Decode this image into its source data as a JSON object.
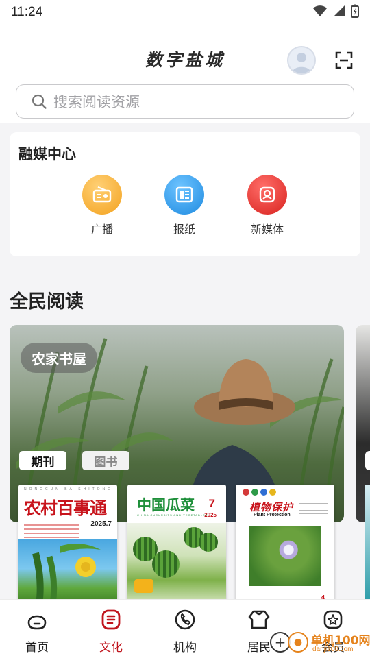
{
  "status_bar": {
    "time": "11:24"
  },
  "header": {
    "title": "数字盐城",
    "search_placeholder": "搜索阅读资源"
  },
  "media_center": {
    "title": "融媒中心",
    "items": [
      {
        "label": "广播",
        "icon": "radio-icon",
        "color": "#f6a92e"
      },
      {
        "label": "报纸",
        "icon": "newspaper-icon",
        "color": "#2f9ae6"
      },
      {
        "label": "新媒体",
        "icon": "new-media-icon",
        "color": "#e43532"
      }
    ]
  },
  "reading": {
    "section_title": "全民阅读",
    "banner_badge": "农家书屋",
    "tabs": [
      {
        "label": "期刊",
        "active": true
      },
      {
        "label": "图书",
        "active": false
      }
    ],
    "books": [
      {
        "subtitle": "NONGCUN BAISHITONG",
        "title": "农村百事通",
        "issue": "2025.7"
      },
      {
        "title": "中国瓜菜",
        "subtitle": "CHINA CUCURBITS AND VEGETABLES",
        "issue_number": "7",
        "year": "2025"
      },
      {
        "title": "植物保护",
        "subtitle": "Plant Protection",
        "issue_number": "4"
      }
    ]
  },
  "bottom_nav": {
    "items": [
      {
        "label": "首页",
        "icon": "home-icon",
        "active": false
      },
      {
        "label": "文化",
        "icon": "culture-icon",
        "active": true
      },
      {
        "label": "机构",
        "icon": "institution-icon",
        "active": false
      },
      {
        "label": "居民",
        "icon": "resident-icon",
        "active": false
      },
      {
        "label": "会员",
        "icon": "member-icon",
        "active": false
      }
    ]
  },
  "watermark": {
    "text": "单机100网",
    "url_text": "danji100.com"
  },
  "colors": {
    "accent": "#c0141c",
    "card_bg": "#ffffff",
    "page_bg": "#f4f4f6"
  }
}
